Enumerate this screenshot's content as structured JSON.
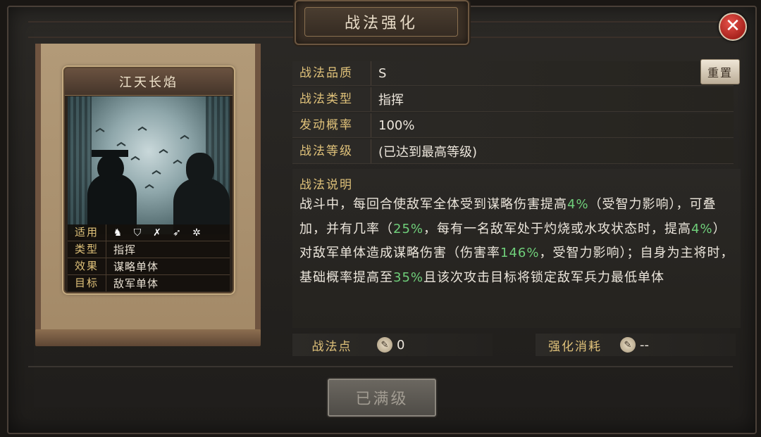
{
  "window": {
    "title": "战法强化",
    "close_icon": "close-icon"
  },
  "card": {
    "name": "江天长焰",
    "rows": [
      {
        "label": "适用",
        "icons": [
          "cavalry-icon",
          "shield-icon",
          "bow-icon",
          "spear-icon",
          "chariot-icon"
        ]
      },
      {
        "label": "类型",
        "value": "指挥"
      },
      {
        "label": "效果",
        "value": "谋略单体"
      },
      {
        "label": "目标",
        "value": "敌军单体"
      }
    ]
  },
  "info": {
    "quality_label": "战法品质",
    "quality_value": "S",
    "reset_label": "重置",
    "type_label": "战法类型",
    "type_value": "指挥",
    "rate_label": "发动概率",
    "rate_value": "100%",
    "level_label": "战法等级",
    "level_value": "(已达到最高等级)"
  },
  "description": {
    "title": "战法说明",
    "p1": "战斗中，每回合使敌军全体受到谋略伤害提高",
    "h1": "4%",
    "p2": "（受智力影响），可叠加，并有几率（",
    "h2": "25%",
    "p3": "，每有一名敌军处于灼烧或水攻状态时，提高",
    "h3": "4%",
    "p4": "）对敌军单体造成谋略伤害（伤害率",
    "h4": "146%",
    "p5": "，受智力影响）；自身为主将时，基础概率提高至",
    "h5": "35%",
    "p6": "且该次攻击目标将锁定敌军兵力最低单体",
    "highlight_color": "#6fcf7a"
  },
  "points": {
    "label": "战法点",
    "value": "0"
  },
  "cost": {
    "label": "强化消耗",
    "value": "--"
  },
  "action": {
    "label": "已满级"
  }
}
